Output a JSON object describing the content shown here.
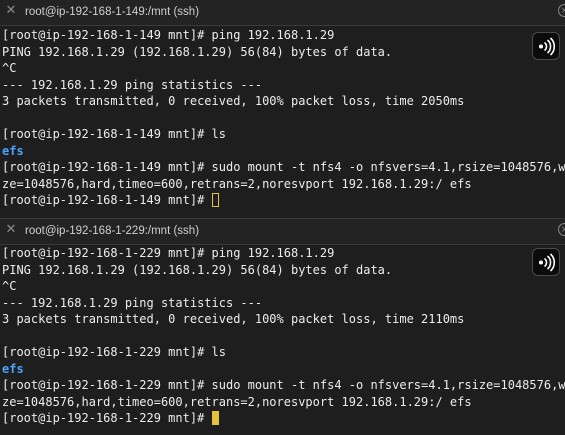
{
  "colors": {
    "background": "#1e1e1e",
    "text": "#ececec",
    "directory": "#4aa3ff",
    "cursor": "#e6c23a"
  },
  "panes": [
    {
      "tab": {
        "title": "root@ip-192-168-1-149:/mnt (ssh)",
        "close_icon": "close-icon"
      },
      "bell_icon": "bell-icon",
      "lines": [
        "[root@ip-192-168-1-149 mnt]# ping 192.168.1.29",
        "PING 192.168.1.29 (192.168.1.29) 56(84) bytes of data.",
        "^C",
        "--- 192.168.1.29 ping statistics ---",
        "3 packets transmitted, 0 received, 100% packet loss, time 2050ms",
        "",
        "[root@ip-192-168-1-149 mnt]# ls",
        "efs",
        "[root@ip-192-168-1-149 mnt]# sudo mount -t nfs4 -o nfsvers=4.1,rsize=1048576,wsi",
        "ze=1048576,hard,timeo=600,retrans=2,noresvport 192.168.1.29:/ efs",
        "[root@ip-192-168-1-149 mnt]# "
      ]
    },
    {
      "tab": {
        "title": "root@ip-192-168-1-229:/mnt (ssh)",
        "close_icon": "close-icon"
      },
      "bell_icon": "bell-icon",
      "lines": [
        "[root@ip-192-168-1-229 mnt]# ping 192.168.1.29",
        "PING 192.168.1.29 (192.168.1.29) 56(84) bytes of data.",
        "^C",
        "--- 192.168.1.29 ping statistics ---",
        "3 packets transmitted, 0 received, 100% packet loss, time 2110ms",
        "",
        "[root@ip-192-168-1-229 mnt]# ls",
        "efs",
        "[root@ip-192-168-1-229 mnt]# sudo mount -t nfs4 -o nfsvers=4.1,rsize=1048576,wsi",
        "ze=1048576,hard,timeo=600,retrans=2,noresvport 192.168.1.29:/ efs",
        "[root@ip-192-168-1-229 mnt]# "
      ]
    }
  ]
}
